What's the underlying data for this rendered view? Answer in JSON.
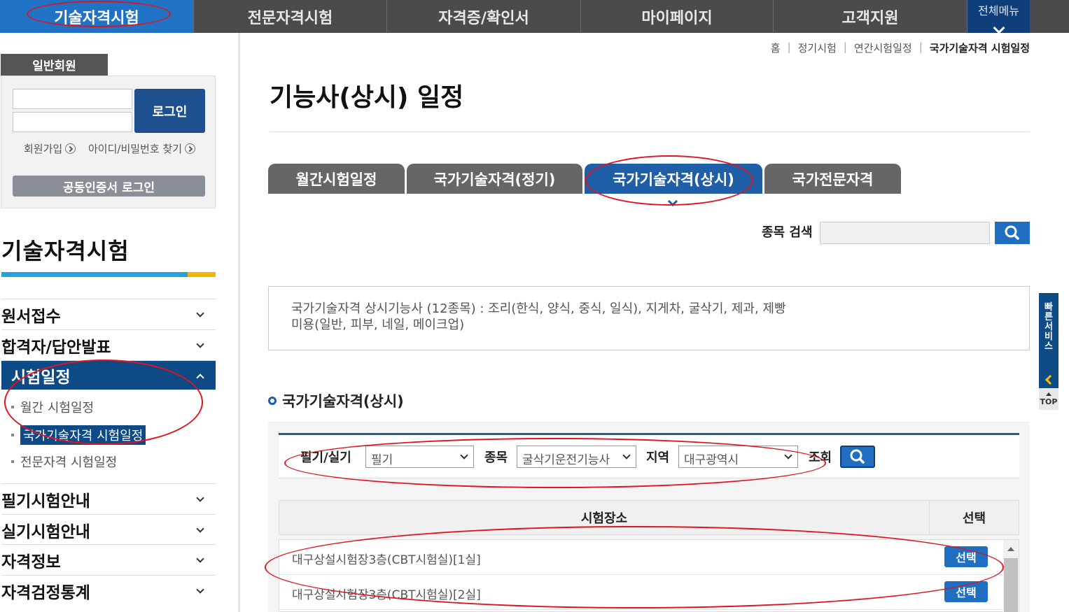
{
  "topnav": {
    "items": [
      "기술자격시험",
      "전문자격시험",
      "자격증/확인서",
      "마이페이지",
      "고객지원"
    ],
    "all_menu": "전체메뉴"
  },
  "login": {
    "member_tab": "일반회원",
    "login_button": "로그인",
    "signup_link": "회원가입",
    "find_link": "아이디/비밀번호 찾기",
    "cert_login": "공동인증서 로그인"
  },
  "sidebar": {
    "title": "기술자격시험",
    "items": [
      "원서접수",
      "합격자/답안발표",
      "시험일정",
      "필기시험안내",
      "실기시험안내",
      "자격정보",
      "자격검정통계"
    ],
    "sub_items": [
      "월간 시험일정",
      "국가기술자격 시험일정",
      "전문자격 시험일정"
    ]
  },
  "breadcrumb": [
    "홈",
    "정기시험",
    "연간시험일정",
    "국가기술자격 시험일정"
  ],
  "page_title": "기능사(상시) 일정",
  "tabs": [
    "월간시험일정",
    "국가기술자격(정기)",
    "국가기술자격(상시)",
    "국가전문자격"
  ],
  "search": {
    "label": "종목 검색",
    "value": ""
  },
  "info": {
    "line1": "국가기술자격 상시기능사 (12종목) : 조리(한식, 양식, 중식, 일식), 지게차, 굴삭기, 제과, 제빵",
    "line2": "미용(일반, 피부, 네일, 메이크업)"
  },
  "section_title": "국가기술자격(상시)",
  "filter": {
    "type_label": "필기/실기",
    "type_value": "필기",
    "item_label": "종목",
    "item_value": "굴삭기운전기능사",
    "region_label": "지역",
    "region_value": "대구광역시",
    "query_label": "조회"
  },
  "table": {
    "headers": [
      "시험장소",
      "선택"
    ],
    "rows": [
      {
        "place": "대구상설시험장3층(CBT시험실)[1실]",
        "select": "선택"
      },
      {
        "place": "대구상설시험장3층(CBT시험실)[2실]",
        "select": "선택"
      }
    ]
  },
  "quick": {
    "label": "빠른서비스",
    "top": "TOP"
  },
  "colors": {
    "primary": "#1f6ec2",
    "navy": "#0e4a85",
    "annotation": "#e0141e"
  }
}
